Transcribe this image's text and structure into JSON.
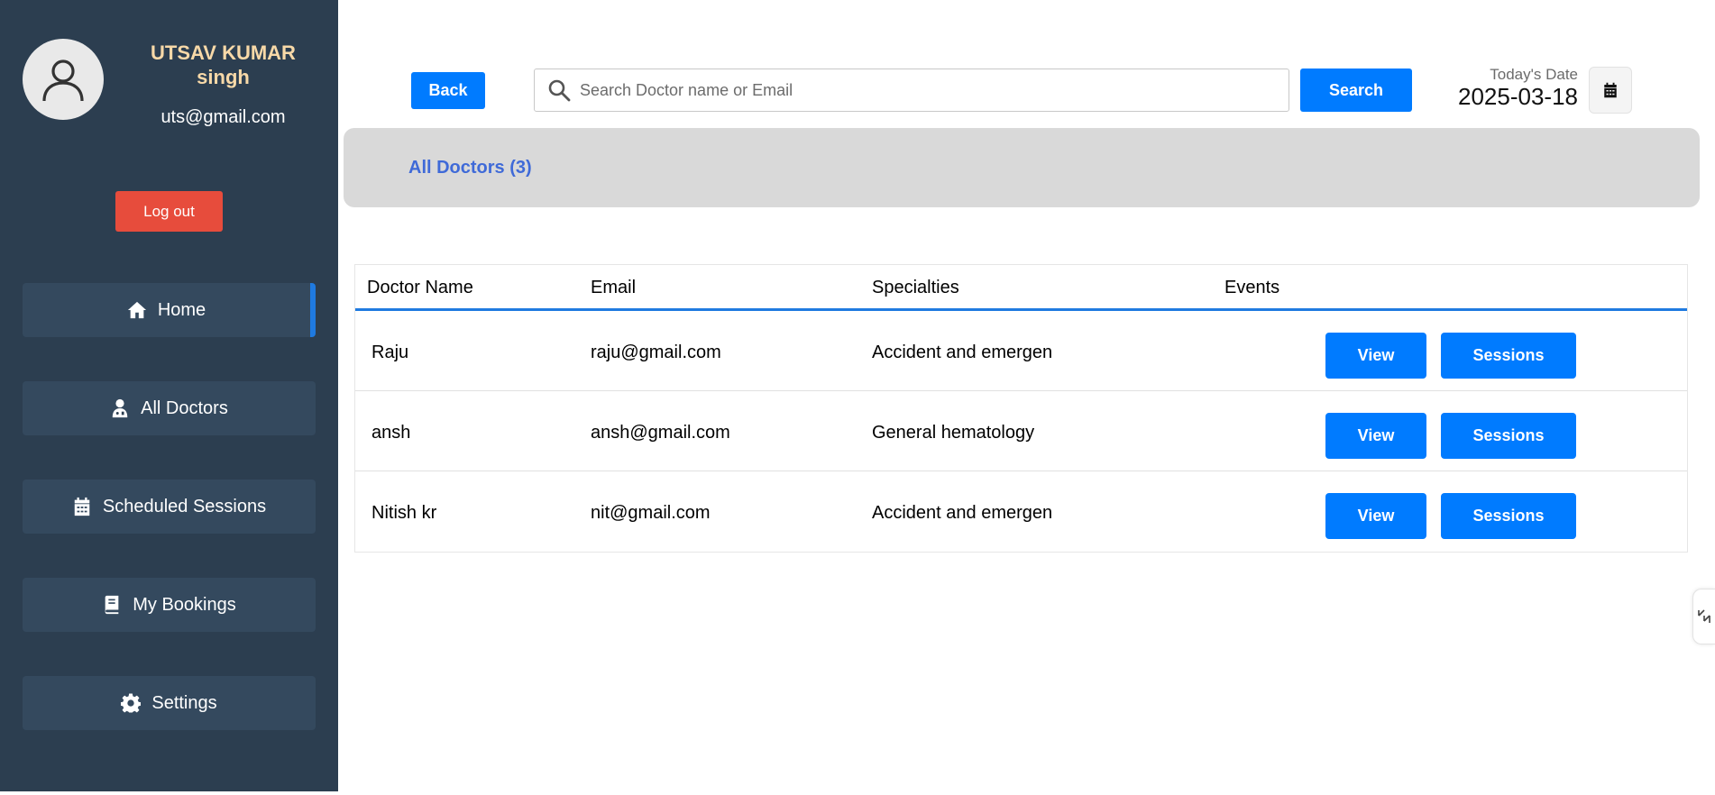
{
  "user": {
    "name": "UTSAV KUMAR singh",
    "email": "uts@gmail.com",
    "logout_label": "Log out"
  },
  "sidebar": {
    "items": [
      {
        "label": "Home",
        "icon": "home-icon",
        "active": true
      },
      {
        "label": "All Doctors",
        "icon": "doctor-icon",
        "active": false
      },
      {
        "label": "Scheduled Sessions",
        "icon": "calendar-icon",
        "active": false
      },
      {
        "label": "My Bookings",
        "icon": "book-icon",
        "active": false
      },
      {
        "label": "Settings",
        "icon": "gear-icon",
        "active": false
      }
    ]
  },
  "header": {
    "back_label": "Back",
    "search_placeholder": "Search Doctor name or Email",
    "search_value": "",
    "search_label": "Search",
    "date_label": "Today's Date",
    "date_value": "2025-03-18"
  },
  "banner": {
    "title": "All Doctors (3)"
  },
  "table": {
    "columns": [
      "Doctor Name",
      "Email",
      "Specialties",
      "Events"
    ],
    "rows": [
      {
        "name": "Raju",
        "email": "raju@gmail.com",
        "specialty": "Accident and emergen",
        "view_label": "View",
        "sessions_label": "Sessions"
      },
      {
        "name": "ansh",
        "email": "ansh@gmail.com",
        "specialty": "General hematology",
        "view_label": "View",
        "sessions_label": "Sessions"
      },
      {
        "name": "Nitish kr",
        "email": "nit@gmail.com",
        "specialty": "Accident and emergen",
        "view_label": "View",
        "sessions_label": "Sessions"
      }
    ]
  },
  "colors": {
    "sidebar_bg": "#2c3e50",
    "nav_item_bg": "#34495e",
    "primary": "#007bff",
    "logout": "#e74c3c",
    "banner_bg": "#d9d9d9",
    "banner_text": "#3f6ad8",
    "username": "#f8d9a8"
  }
}
